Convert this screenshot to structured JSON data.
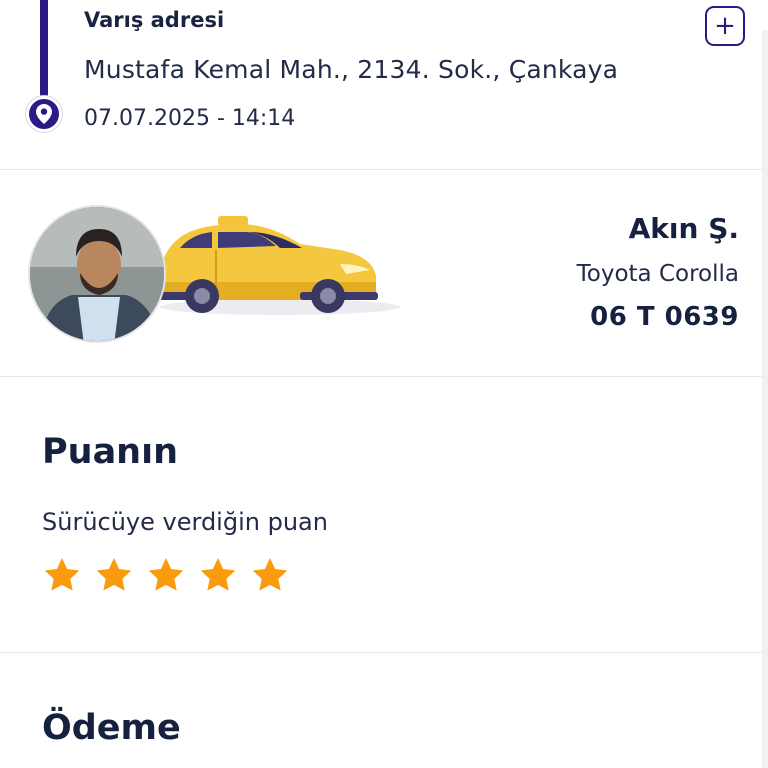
{
  "destination": {
    "label": "Varış adresi",
    "address": "Mustafa Kemal Mah., 2134. Sok., Çankaya",
    "datetime": "07.07.2025 - 14:14",
    "add_button_label": "+"
  },
  "driver": {
    "name": "Akın Ş.",
    "car_model": "Toyota Corolla",
    "plate": "06 T 0639"
  },
  "rating": {
    "title": "Puanın",
    "subtitle": "Sürücüye verdiğin puan",
    "stars": 5,
    "max_stars": 5
  },
  "payment": {
    "title": "Ödeme"
  },
  "colors": {
    "brand": "#2a1b86",
    "star": "#f99b0c",
    "taxi": "#f2c23a",
    "text": "#16213f"
  },
  "icons": {
    "pin": "location-pin-icon",
    "add": "plus-icon",
    "star": "star-icon"
  }
}
